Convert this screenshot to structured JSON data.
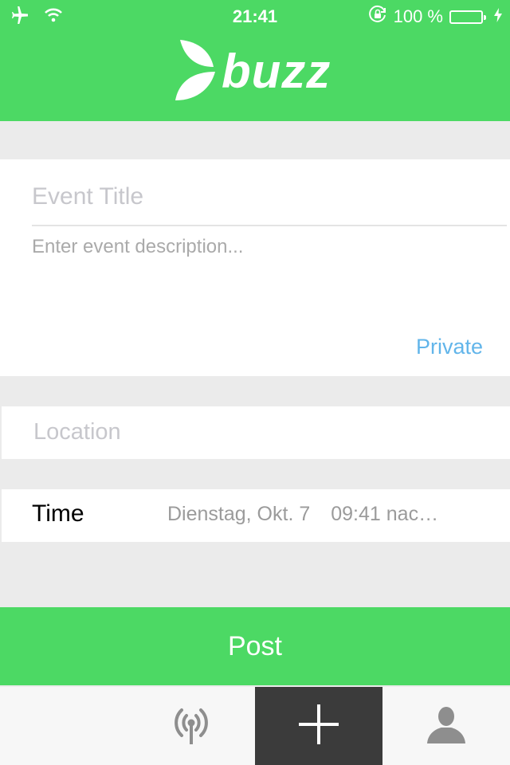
{
  "status_bar": {
    "time": "21:41",
    "battery_text": "100 %",
    "icons": [
      "airplane-icon",
      "wifi-icon",
      "rotation-lock-icon",
      "battery-icon",
      "charging-bolt-icon"
    ]
  },
  "header": {
    "logo_text": "buzz",
    "background_color": "#4cd964"
  },
  "event_form": {
    "title_placeholder": "Event Title",
    "description_placeholder": "Enter event description...",
    "private_label": "Private",
    "location_placeholder": "Location",
    "time_label": "Time",
    "time_date": "Dienstag, Okt. 7",
    "time_clock": "09:41 nac…"
  },
  "post_button": {
    "label": "Post"
  },
  "tab_bar": {
    "items": [
      {
        "icon": "broadcast-antenna-icon"
      },
      {
        "icon": "plus-icon",
        "active": true
      },
      {
        "icon": "profile-icon"
      }
    ],
    "active_color": "#3b3b3b"
  },
  "colors": {
    "accent": "#4cd964",
    "link": "#62b5ea",
    "placeholder": "#c7c7cc",
    "secondary_text": "#9b9b9b"
  }
}
